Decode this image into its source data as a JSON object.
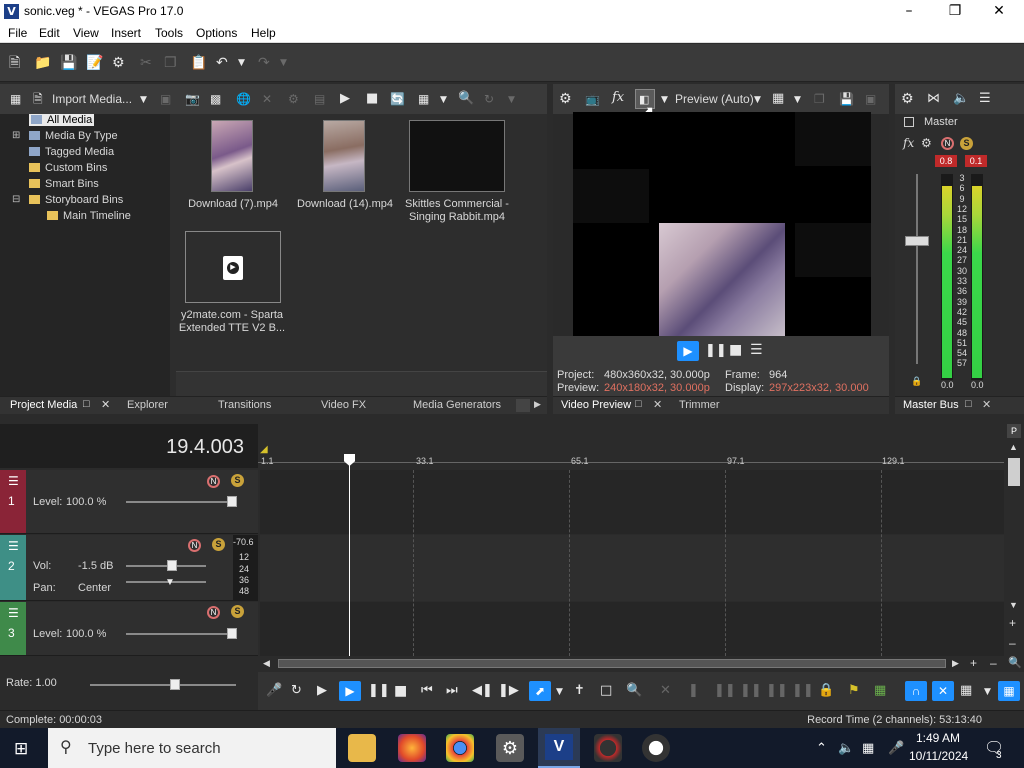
{
  "window": {
    "title": "sonic.veg * - VEGAS Pro 17.0",
    "app_icon": "V"
  },
  "menu": [
    "File",
    "Edit",
    "View",
    "Insert",
    "Tools",
    "Options",
    "Help"
  ],
  "project_media": {
    "import_label": "Import Media...",
    "tree": [
      "All Media",
      "Media By Type",
      "Tagged Media",
      "Custom Bins",
      "Smart Bins",
      "Storyboard Bins",
      "Main Timeline"
    ],
    "items": [
      {
        "name": "Download (7).mp4"
      },
      {
        "name": "Download (14).mp4"
      },
      {
        "name": "Skittles Commercial - Singing Rabbit.mp4",
        "line1": "Skittles Commercial -",
        "line2": "Singing Rabbit.mp4"
      },
      {
        "name": "y2mate.com - Sparta Extended TTE V2 B...",
        "line1": "y2mate.com - Sparta",
        "line2": "Extended TTE V2 B..."
      }
    ]
  },
  "left_tabs": [
    "Project Media",
    "Explorer",
    "Transitions",
    "Video FX",
    "Media Generators"
  ],
  "preview": {
    "mode": "Preview (Auto)",
    "project_label": "Project:",
    "project_value": "480x360x32, 30.000p",
    "preview_label": "Preview:",
    "preview_value": "240x180x32, 30.000p",
    "frame_label": "Frame:",
    "frame_value": "964",
    "display_label": "Display:",
    "display_value": "297x223x32, 30.000"
  },
  "preview_tabs": [
    "Video Preview",
    "Trimmer"
  ],
  "master": {
    "label": "Master",
    "peak_left": "0.8",
    "peak_right": "0.1",
    "scale": [
      "3",
      "6",
      "9",
      "12",
      "15",
      "18",
      "21",
      "24",
      "27",
      "30",
      "33",
      "36",
      "39",
      "42",
      "45",
      "48",
      "51",
      "54",
      "57"
    ],
    "bottom_left": "0.0",
    "bottom_right": "0.0",
    "tab": "Master Bus",
    "meter_level_left": 0.95,
    "meter_level_right": 0.95
  },
  "timeline": {
    "timecode": "19.4.003",
    "ruler": [
      "1.1",
      "33.1",
      "65.1",
      "97.1",
      "129.1"
    ],
    "tracks": [
      {
        "num": "1",
        "level_label": "Level:",
        "level_value": "100.0 %"
      },
      {
        "num": "2",
        "vol_label": "Vol:",
        "vol_value": "-1.5 dB",
        "pan_label": "Pan:",
        "pan_value": "Center",
        "meter_top": "-70.6",
        "meter_scale": [
          "12",
          "24",
          "36",
          "48"
        ]
      },
      {
        "num": "3",
        "level_label": "Level:",
        "level_value": "100.0 %"
      }
    ],
    "rate_label": "Rate: 1.00"
  },
  "status": {
    "left": "Complete: 00:00:03",
    "right": "Record Time (2 channels): 53:13:40"
  },
  "taskbar": {
    "search_placeholder": "Type here to search",
    "time": "1:49 AM",
    "date": "10/11/2024",
    "notifications": "3"
  },
  "colors": {
    "accent": "#1e90ff",
    "track1": "#8a2437",
    "track2": "#3e8f86",
    "track3": "#3f8a4a",
    "meter": "#34d044"
  }
}
